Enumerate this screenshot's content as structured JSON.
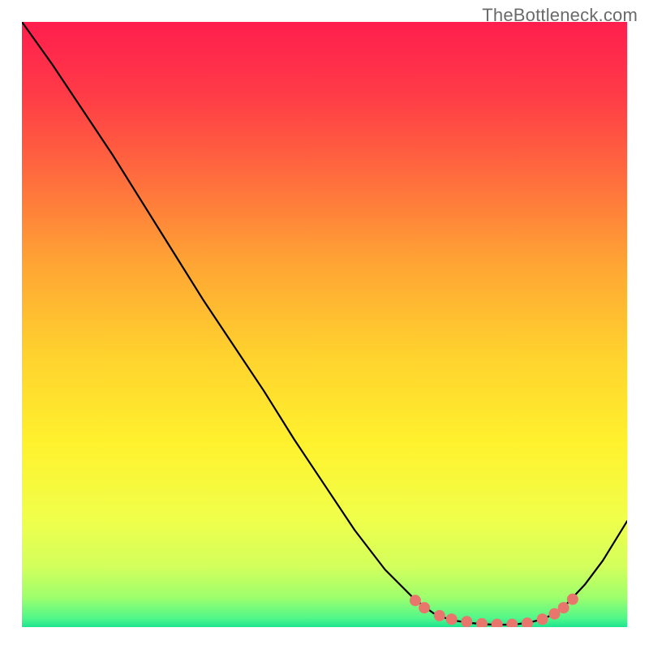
{
  "watermark": "TheBottleneck.com",
  "chart_data": {
    "type": "line",
    "title": "",
    "xlabel": "",
    "ylabel": "",
    "xlim": [
      0,
      100
    ],
    "ylim": [
      0,
      100
    ],
    "series": [
      {
        "name": "curve",
        "color": "#000000",
        "x": [
          0,
          5,
          10,
          15,
          20,
          25,
          30,
          35,
          40,
          45,
          50,
          55,
          60,
          65,
          68,
          70,
          72,
          74,
          76,
          78,
          80,
          82,
          84,
          86,
          88,
          90,
          93,
          96,
          100
        ],
        "y": [
          100,
          93,
          85.5,
          78,
          70,
          62,
          54,
          46.5,
          39,
          31,
          23.5,
          16,
          9.5,
          4.5,
          2.3,
          1.5,
          1.0,
          0.7,
          0.5,
          0.4,
          0.4,
          0.5,
          0.8,
          1.3,
          2.2,
          3.8,
          7.0,
          11.0,
          17.5
        ]
      }
    ],
    "markers": {
      "name": "points",
      "color": "#E8766D",
      "radius_px": 7,
      "x": [
        65,
        66.5,
        69,
        71,
        73.5,
        76,
        78.5,
        81,
        83.5,
        86,
        88,
        89.5,
        91
      ],
      "y": [
        4.4,
        3.2,
        1.9,
        1.3,
        0.9,
        0.55,
        0.45,
        0.45,
        0.65,
        1.3,
        2.2,
        3.2,
        4.6
      ]
    },
    "background": {
      "type": "vertical-gradient",
      "stops": [
        {
          "offset": 0.0,
          "color": "#FF1E4E"
        },
        {
          "offset": 0.12,
          "color": "#FF3B47"
        },
        {
          "offset": 0.25,
          "color": "#FF6A3E"
        },
        {
          "offset": 0.4,
          "color": "#FFA534"
        },
        {
          "offset": 0.55,
          "color": "#FFD22E"
        },
        {
          "offset": 0.7,
          "color": "#FFF22E"
        },
        {
          "offset": 0.82,
          "color": "#F0FF4A"
        },
        {
          "offset": 0.9,
          "color": "#D3FF5C"
        },
        {
          "offset": 0.95,
          "color": "#9FFF6C"
        },
        {
          "offset": 0.985,
          "color": "#52F78A"
        },
        {
          "offset": 1.0,
          "color": "#1DE590"
        }
      ]
    }
  }
}
